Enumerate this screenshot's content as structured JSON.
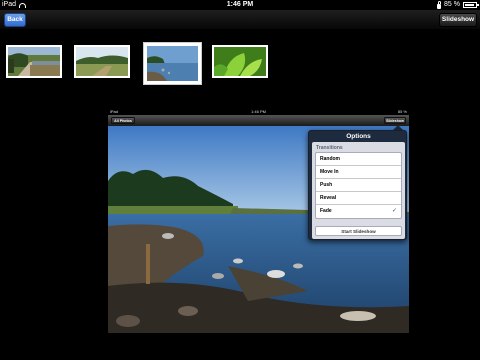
{
  "statusbar": {
    "device": "iPad",
    "time": "1:46 PM",
    "battery": "85 %",
    "battery_level": 0.85
  },
  "navbar": {
    "back_label": "Back",
    "slideshow_label": "Slideshow"
  },
  "thumbnails": [
    {
      "name": "road-landscape"
    },
    {
      "name": "field-landscape"
    },
    {
      "name": "lake-landscape",
      "selected": true
    },
    {
      "name": "green-leaf"
    }
  ],
  "embedded": {
    "device": "iPad",
    "time": "1:46 PM",
    "battery": "85 %",
    "back_label": "All Photos",
    "slideshow_label": "Slideshow"
  },
  "options": {
    "title": "Options",
    "section": "Transitions",
    "items": [
      {
        "label": "Random",
        "checked": false
      },
      {
        "label": "Move In",
        "checked": false
      },
      {
        "label": "Push",
        "checked": false
      },
      {
        "label": "Reveal",
        "checked": false
      },
      {
        "label": "Fade",
        "checked": true
      }
    ],
    "check_glyph": "✓",
    "start_label": "Start Slideshow"
  }
}
